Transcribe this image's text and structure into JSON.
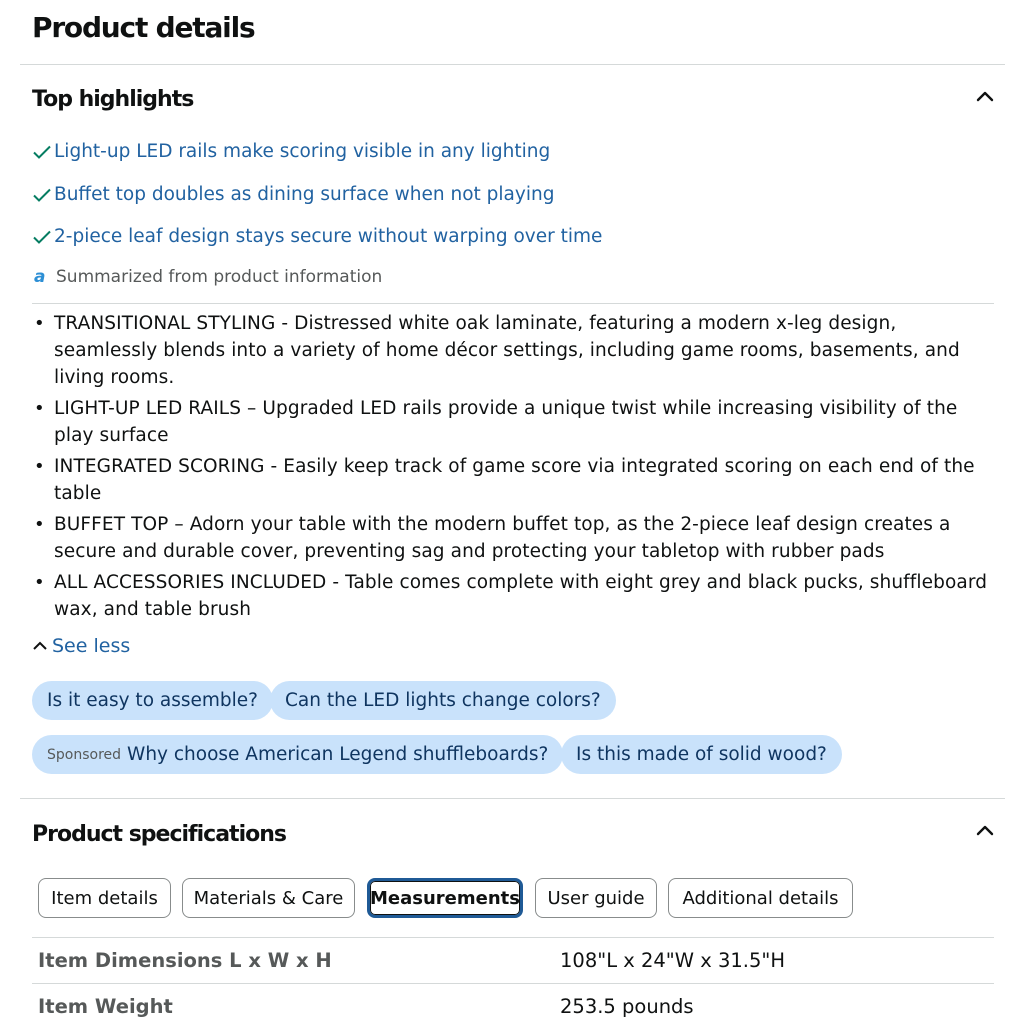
{
  "page_title": "Product details",
  "top_highlights": {
    "title": "Top highlights",
    "items": [
      "Light-up LED rails make scoring visible in any lighting",
      "Buffet top doubles as dining surface when not playing",
      "2-piece leaf design stays secure without warping over time"
    ],
    "summary_note": "Summarized from product information",
    "bullets": [
      "TRANSITIONAL STYLING - Distressed white oak laminate, featuring a modern x-leg design, seamlessly blends into a variety of home décor settings, including game rooms, basements, and living rooms.",
      "LIGHT-UP LED RAILS – Upgraded LED rails provide a unique twist while increasing visibility of the play surface",
      "INTEGRATED SCORING - Easily keep track of game score via integrated scoring on each end of the table",
      "BUFFET TOP – Adorn your table with the modern buffet top, as the 2-piece leaf design creates a secure and durable cover, preventing sag and protecting your tabletop with rubber pads",
      "ALL ACCESSORIES INCLUDED - Table comes complete with eight grey and black pucks, shuffleboard wax, and table brush"
    ],
    "see_less": "See less"
  },
  "questions": {
    "row1": [
      "Is it easy to assemble?",
      "Can the LED lights change colors?"
    ],
    "sponsored_label": "Sponsored",
    "sponsored_question": "Why choose American Legend shuffleboards?",
    "row2_other": "Is this made of solid wood?"
  },
  "specs": {
    "title": "Product specifications",
    "tabs": [
      "Item details",
      "Materials & Care",
      "Measurements",
      "User guide",
      "Additional details"
    ],
    "active_tab": "Measurements",
    "rows": [
      {
        "label": "Item Dimensions L x W x H",
        "value": "108\"L x 24\"W x 31.5\"H"
      },
      {
        "label": "Item Weight",
        "value": "253.5 pounds"
      }
    ]
  },
  "colors": {
    "link": "#2162a1",
    "check": "#067d62",
    "chip_bg": "#c9e2fb",
    "active_tab_border": "#1f5a96"
  }
}
